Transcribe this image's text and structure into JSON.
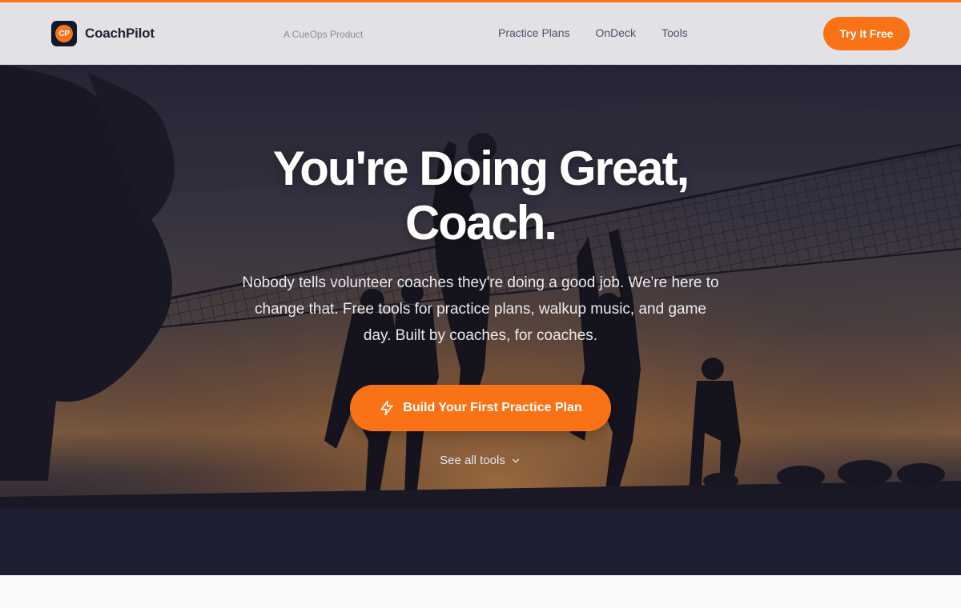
{
  "header": {
    "brand_logo_text": "CP",
    "brand_name": "CoachPilot",
    "tagline": "A CueOps Product",
    "nav": [
      {
        "label": "Practice Plans"
      },
      {
        "label": "OnDeck"
      },
      {
        "label": "Tools"
      }
    ],
    "cta_label": "Try It Free"
  },
  "hero": {
    "title_line1": "You're Doing Great,",
    "title_line2": "Coach.",
    "subtitle": "Nobody tells volunteer coaches they're doing a good job. We're here to change that. Free tools for practice plans, walkup music, and game day. Built by coaches, for coaches.",
    "cta_label": "Build Your First Practice Plan",
    "cta_icon": "lightning-bolt-icon",
    "secondary_label": "See all tools",
    "secondary_icon": "chevron-down-icon"
  },
  "colors": {
    "accent": "#f97316",
    "header_bg": "#e2e2e6",
    "brand_text": "#1f2433",
    "nav_text": "#4b5068"
  }
}
